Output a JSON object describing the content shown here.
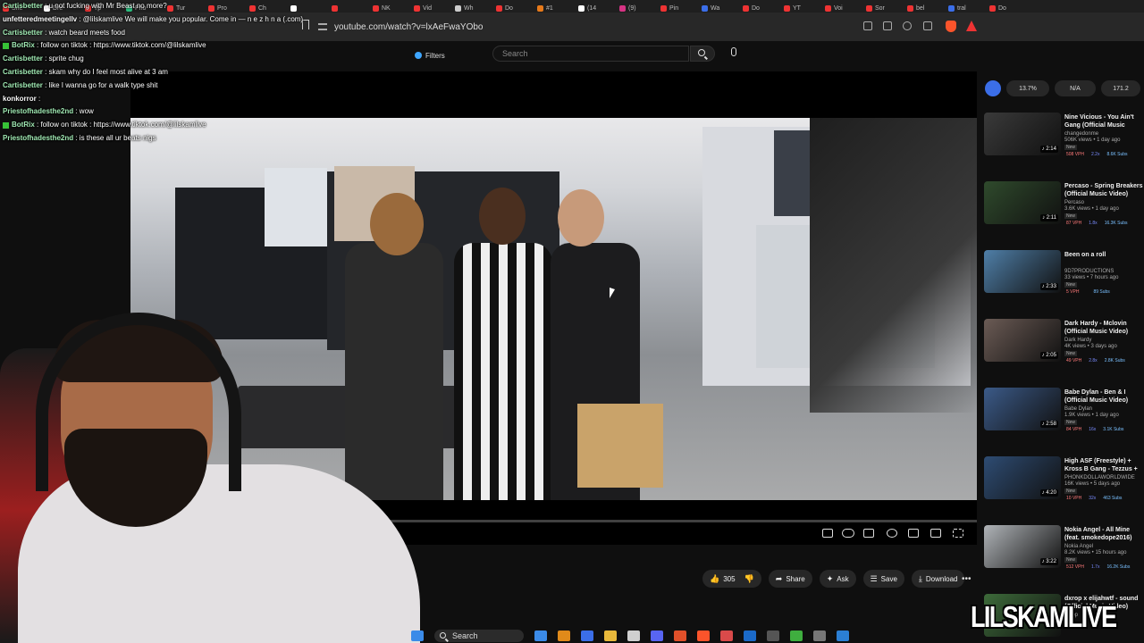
{
  "browser": {
    "tabs": [
      {
        "label": "Sne",
        "color": "#e33"
      },
      {
        "label": "Dre",
        "color": "#fff"
      },
      {
        "label": "Tp",
        "color": "#e33"
      },
      {
        "label": "Pho",
        "color": "#2bbf7f"
      },
      {
        "label": "Tur",
        "color": "#e33"
      },
      {
        "label": "Pro",
        "color": "#e33"
      },
      {
        "label": "Ch",
        "color": "#e33"
      },
      {
        "label": "",
        "color": "#fff"
      },
      {
        "label": "",
        "color": "#e33"
      },
      {
        "label": "NK",
        "color": "#e33"
      },
      {
        "label": "Vid",
        "color": "#e33"
      },
      {
        "label": "Wh",
        "color": "#ccc"
      },
      {
        "label": "Do",
        "color": "#e33"
      },
      {
        "label": "#1",
        "color": "#e77a1a"
      },
      {
        "label": "(14",
        "color": "#fff"
      },
      {
        "label": "(9)",
        "color": "#d63384"
      },
      {
        "label": "Pin",
        "color": "#e33"
      },
      {
        "label": "Wa",
        "color": "#3b6ee8"
      },
      {
        "label": "Do",
        "color": "#e33"
      },
      {
        "label": "YT",
        "color": "#e33"
      },
      {
        "label": "Voi",
        "color": "#e33"
      },
      {
        "label": "Sor",
        "color": "#e33"
      },
      {
        "label": "bel",
        "color": "#e33"
      },
      {
        "label": "tral",
        "color": "#3b6ee8"
      },
      {
        "label": "Do",
        "color": "#e33"
      }
    ],
    "url": "youtube.com/watch?v=lxAeFwaYObo"
  },
  "yt_header": {
    "filters_label": "Filters",
    "search_placeholder": "Search"
  },
  "player": {
    "progress": 0.02
  },
  "actions": {
    "like_count": "305",
    "share": "Share",
    "ask": "Ask",
    "save": "Save",
    "download": "Download",
    "more": "•••"
  },
  "sidebar": {
    "chips": [
      "13.7%",
      "N/A",
      "171.2"
    ],
    "items": [
      {
        "title": "Nine Vicious - You Ain't Gang (Official Music Video)",
        "channel": "changedonme",
        "meta": "506K views • 1 day ago",
        "duration": "2:14",
        "stats": [
          "508 VPH",
          "2.2x",
          "8.6K Subs"
        ],
        "thumb": "#3a3a3a"
      },
      {
        "title": "Percaso - Spring Breakers (Official Music Video)",
        "channel": "Percaso",
        "meta": "3.6K views • 1 day ago",
        "duration": "2:11",
        "stats": [
          "87 VPH",
          "1.8x",
          "16.3K Subs"
        ],
        "thumb": "#2f4a2c"
      },
      {
        "title": "Been on a roll",
        "channel": "9D7PRODUCTIONS",
        "meta": "33 views • 7 hours ago",
        "duration": "2:33",
        "stats": [
          "5 VPH",
          "",
          "89 Subs"
        ],
        "thumb": "#4f7fa8"
      },
      {
        "title": "Dark Hardy - Mclovin (Official Music Video)",
        "channel": "Dark Hardy",
        "meta": "4K views • 3 days ago",
        "duration": "2:05",
        "stats": [
          "49 VPH",
          "2.8x",
          "2.8K Subs"
        ],
        "thumb": "#6b5b55"
      },
      {
        "title": "Babe Dylan - Ben & I (Official Music Video)",
        "channel": "Babe Dylan",
        "meta": "1.9K views • 1 day ago",
        "duration": "2:58",
        "stats": [
          "84 VPH",
          "16x",
          "3.1K Subs"
        ],
        "thumb": "#3b5a88"
      },
      {
        "title": "High ASF (Freestyle) + Kross B Gang - Tezzus + ShawtyRo",
        "channel": "PHONKDOLLAWORLDWIDE",
        "meta": "16K views • 5 days ago",
        "duration": "4:20",
        "stats": [
          "10 VPH",
          "32x",
          "463 Subs"
        ],
        "thumb": "#2e4c73"
      },
      {
        "title": "Nokia Angel - All Mine (feat. smokedope2016)",
        "channel": "Nokia Angel",
        "meta": "8.2K views • 15 hours ago",
        "duration": "3:22",
        "stats": [
          "512 VPH",
          "1.7x",
          "16.2K Subs"
        ],
        "thumb": "#b0b4b8"
      },
      {
        "title": "dxrop x elijahwtf - sound (Official Music Video)",
        "channel": "dxrop",
        "meta": "",
        "duration": "",
        "stats": [],
        "thumb": "#3d6b3a"
      }
    ]
  },
  "chat": [
    {
      "user": "Cartisbetter",
      "msg": ": u not fucking with Mr Beast no more?",
      "badge": false
    },
    {
      "user": "unfetteredmeetingellv",
      "msg": ": @lilskamlive We will make you popular. Come in — n e z h n a (.com)",
      "badge": false,
      "alt": true
    },
    {
      "user": "Cartisbetter",
      "msg": ": watch beard meets food",
      "badge": false
    },
    {
      "user": "BotRix",
      "msg": ": follow on tiktok : https://www.tiktok.com/@lilskamlive",
      "badge": true
    },
    {
      "user": "Cartisbetter",
      "msg": ": sprite chug",
      "badge": false
    },
    {
      "user": "Cartisbetter",
      "msg": ": skam why do I feel most alive at 3 am",
      "badge": false
    },
    {
      "user": "Cartisbetter",
      "msg": ": like I wanna go for a walk type shit",
      "badge": false
    },
    {
      "user": "konkorror",
      "msg": ":",
      "badge": false,
      "alt": true
    },
    {
      "user": "Priestofhadesthe2nd",
      "msg": ": wow",
      "badge": false
    },
    {
      "user": "BotRix",
      "msg": ": follow on tiktok : https://www.tiktok.com/@lilskamlive",
      "badge": true
    },
    {
      "user": "Priestofhadesthe2nd",
      "msg": ": is these all ur beats nigs",
      "badge": false
    }
  ],
  "taskbar": {
    "search_label": "Search",
    "icons": [
      "#3b8be8",
      "#e08a1a",
      "#3b6ee8",
      "#e8b83b",
      "#cfcfcf",
      "#5865f2",
      "#e0502a",
      "#fb542b",
      "#d94a4a",
      "#1b6ac9",
      "#555",
      "#3fae3f",
      "#777",
      "#2b7fd4"
    ]
  },
  "watermark": "LILSKAMLIVE"
}
